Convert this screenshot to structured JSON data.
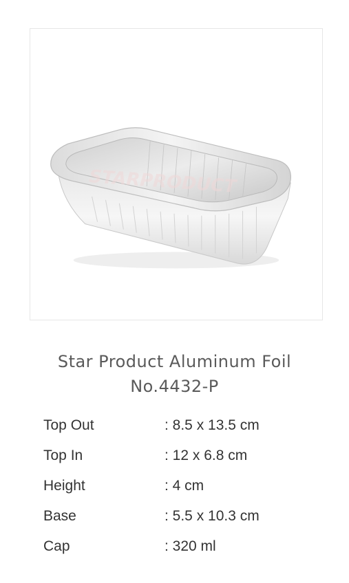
{
  "product": {
    "image_icon": "aluminum-foil-tray-image",
    "watermark": "STARPRODUCT",
    "title_line1": "Star Product Aluminum Foil",
    "title_line2": "No.4432-P"
  },
  "specs": [
    {
      "label": "Top Out",
      "value": ": 8.5 x 13.5 cm"
    },
    {
      "label": "Top In",
      "value": ": 12 x 6.8 cm"
    },
    {
      "label": "Height",
      "value": ": 4 cm"
    },
    {
      "label": "Base",
      "value": ": 5.5 x 10.3 cm"
    },
    {
      "label": "Cap",
      "value": ": 320 ml"
    }
  ]
}
